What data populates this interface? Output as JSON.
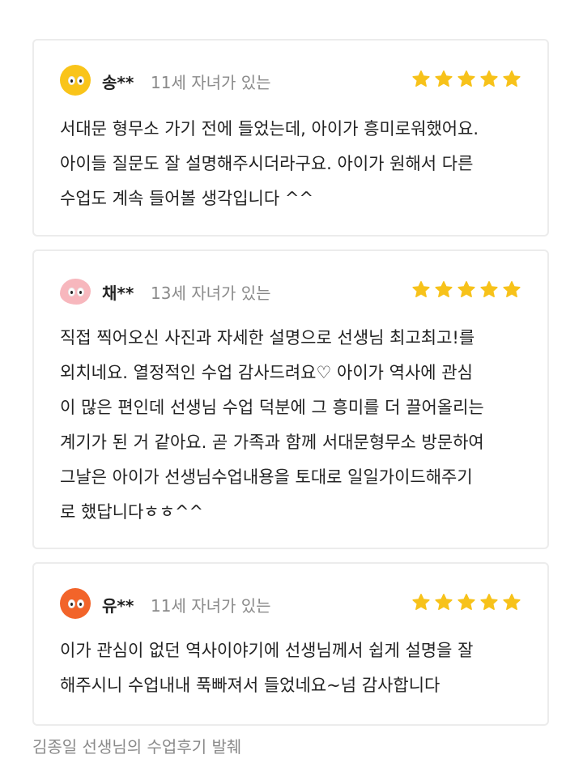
{
  "colors": {
    "star": "#F7C21A",
    "card_border": "#ECECEC",
    "muted_text": "#8A8A8A"
  },
  "reviews": [
    {
      "reviewer": "송**",
      "child_age": "11세 자녀가 있는",
      "rating": 5,
      "avatar": {
        "icon": "yellow-face-avatar-icon",
        "color": "#F9C41A"
      },
      "lines": [
        "서대문 형무소 가기 전에 들었는데, 아이가 흥미로워했어요.",
        "아이들 질문도 잘 설명해주시더라구요. 아이가 원해서 다른",
        "수업도 계속 들어볼 생각입니다 ^^"
      ]
    },
    {
      "reviewer": "채**",
      "child_age": "13세 자녀가 있는",
      "rating": 5,
      "avatar": {
        "icon": "pink-blob-avatar-icon",
        "color": "#F7B7BD"
      },
      "lines": [
        "직접 찍어오신 사진과 자세한 설명으로 선생님 최고최고!를",
        "외치네요. 열정적인 수업 감사드려요♡ 아이가 역사에 관심",
        "이 많은 편인데 선생님 수업 덕분에 그 흥미를 더 끌어올리는",
        "계기가 된 거 같아요. 곧 가족과 함께 서대문형무소 방문하여",
        "그날은 아이가 선생님수업내용을 토대로 일일가이드해주기",
        "로 했답니다ㅎㅎ^^"
      ]
    },
    {
      "reviewer": "유**",
      "child_age": "11세 자녀가 있는",
      "rating": 5,
      "avatar": {
        "icon": "orange-face-avatar-icon",
        "color": "#F2642A"
      },
      "lines": [
        "이가 관심이 없던 역사이야기에 선생님께서 쉽게 설명을 잘",
        "해주시니 수업내내 푹빠져서 들었네요~넘 감사합니다"
      ]
    }
  ],
  "footer": {
    "caption": "김종일 선생님의 수업후기 발췌"
  }
}
